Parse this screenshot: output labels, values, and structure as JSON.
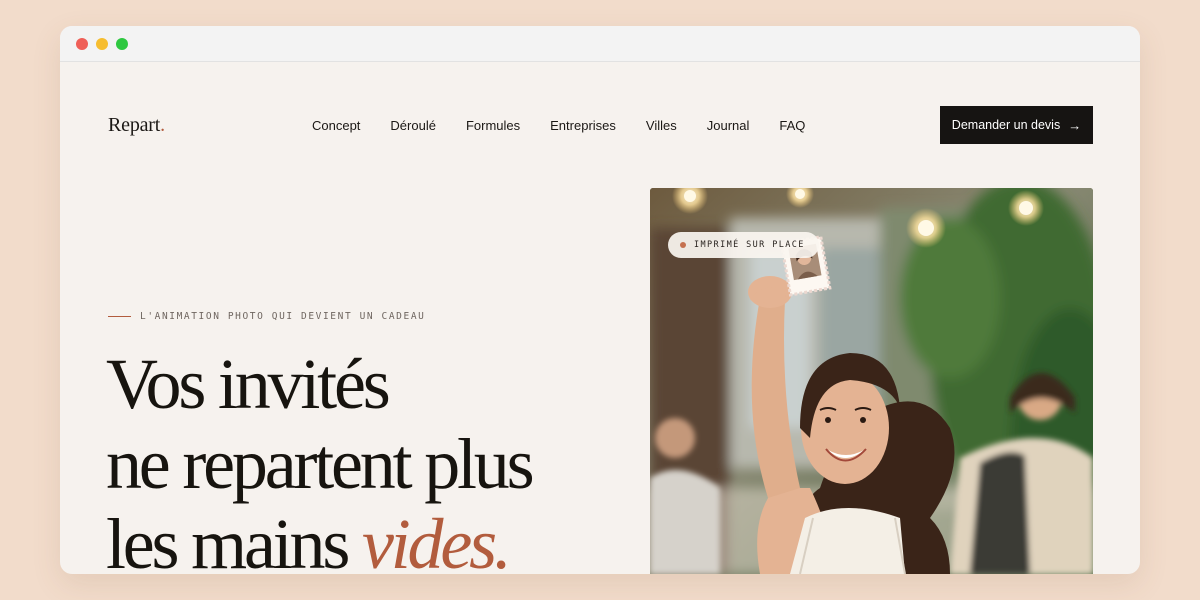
{
  "brand": {
    "name": "Repart",
    "dot": "."
  },
  "nav": {
    "items": [
      "Concept",
      "Déroulé",
      "Formules",
      "Entreprises",
      "Villes",
      "Journal",
      "FAQ"
    ]
  },
  "cta": {
    "label": "Demander un devis",
    "arrow": "→"
  },
  "hero": {
    "eyebrow": "L'animation photo qui devient un cadeau",
    "headline_line1": "Vos invités",
    "headline_line2": "ne repartent plus",
    "headline_line3_prefix": "les mains ",
    "headline_accent": "vides."
  },
  "badge": {
    "label": "Imprimé sur place"
  },
  "colors": {
    "accent": "#b25c3d",
    "background": "#f6f2ee",
    "cta_background": "#161412",
    "page_backdrop": "#f2dccb"
  },
  "icons": {
    "cta_arrow": "arrow-right-icon",
    "badge_dot": "status-dot-icon"
  }
}
